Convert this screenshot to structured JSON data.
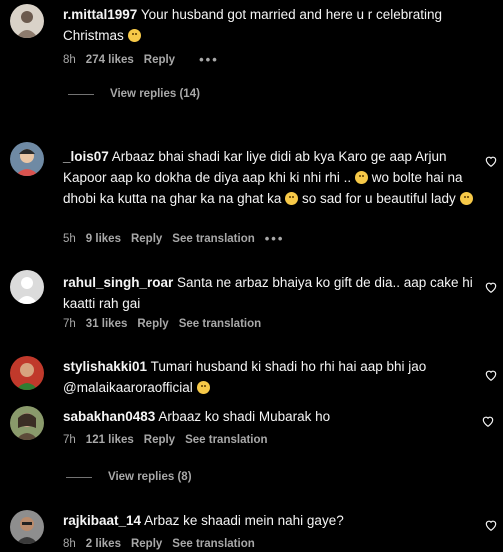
{
  "comments": [
    {
      "user": "r.mittal1997",
      "text": "Your husband got married and here u r celebrating Christmas",
      "time": "8h",
      "likes": "274 likes",
      "reply": "Reply",
      "view_replies": "View replies (14)"
    },
    {
      "user": "_lois07",
      "text": "Arbaaz bhai shadi kar liye didi ab kya Karo ge aap Arjun Kapoor aap ko dokha de diya aap khi ki nhi rhi ..",
      "text2": "wo bolte hai na dhobi ka kutta na ghar ka na ghat ka",
      "text3": "so sad for u beautiful lady",
      "time": "5h",
      "likes": "9 likes",
      "reply": "Reply",
      "translation": "See translation"
    },
    {
      "user": "rahul_singh_roar",
      "text": "Santa ne arbaz bhaiya ko gift de dia.. aap cake hi kaatti rah gai",
      "time": "7h",
      "likes": "31 likes",
      "reply": "Reply",
      "translation": "See translation"
    },
    {
      "user": "stylishakki01",
      "text": "Tumari husband ki shadi ho rhi hai aap bhi jao @malaikaaroraofficial",
      "time": "",
      "likes": "",
      "reply": ""
    },
    {
      "user": "sabakhan0483",
      "text": "Arbaaz ko shadi Mubarak ho",
      "time": "7h",
      "likes": "121 likes",
      "reply": "Reply",
      "translation": "See translation",
      "view_replies": "View replies (8)"
    },
    {
      "user": "rajkibaat_14",
      "text": "Arbaz ke shaadi mein nahi gaye?",
      "time": "8h",
      "likes": "2 likes",
      "reply": "Reply",
      "translation": "See translation"
    }
  ],
  "colors": {
    "background": "#000000",
    "text": "#f5f5f5",
    "meta": "#a8a8a8"
  },
  "icons": [
    "heart-icon",
    "more-options-icon",
    "emoji-icon"
  ]
}
